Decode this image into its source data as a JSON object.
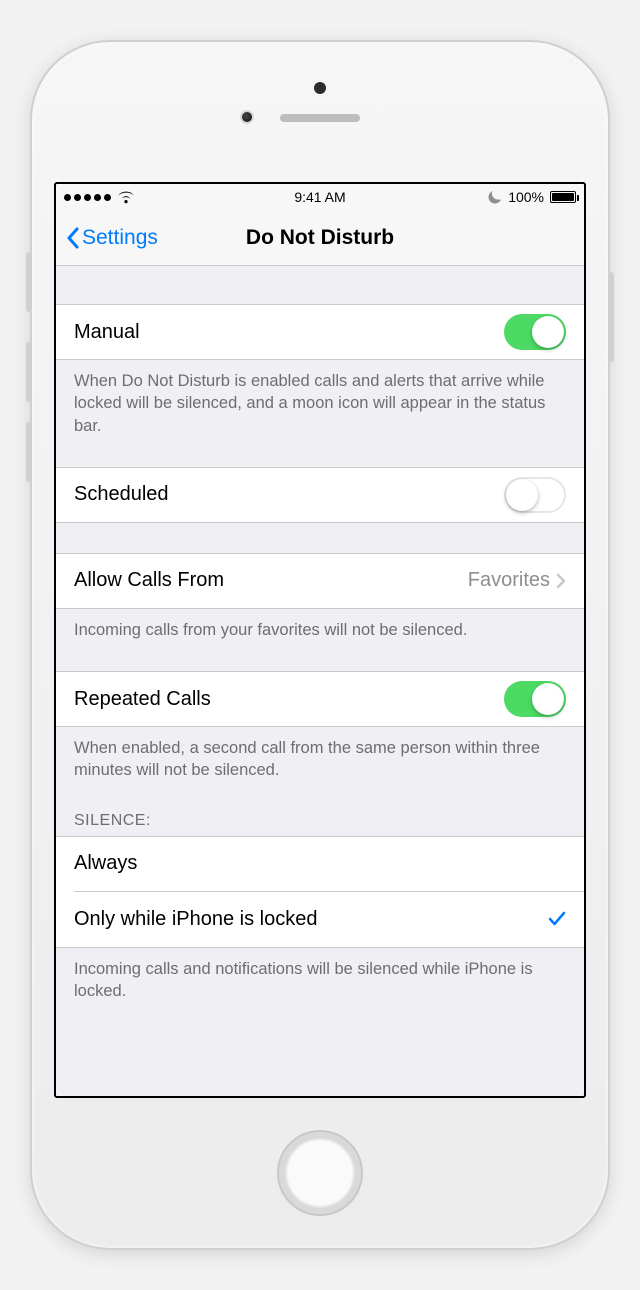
{
  "statusbar": {
    "time": "9:41 AM",
    "battery_pct": "100%",
    "signal_dots": 5,
    "carrier_icon": "wifi",
    "dnd_indicator": "moon"
  },
  "nav": {
    "back_label": "Settings",
    "title": "Do Not Disturb"
  },
  "rows": {
    "manual": {
      "label": "Manual",
      "on": true
    },
    "manual_footer": "When Do Not Disturb is enabled calls and alerts that arrive while locked will be silenced, and a moon icon will appear in the status bar.",
    "scheduled": {
      "label": "Scheduled",
      "on": false
    },
    "allow_calls": {
      "label": "Allow Calls From",
      "value": "Favorites"
    },
    "allow_calls_footer": "Incoming calls from your favorites will not be silenced.",
    "repeated": {
      "label": "Repeated Calls",
      "on": true
    },
    "repeated_footer": "When enabled, a second call from the same person within three minutes will not be silenced.",
    "silence_header": "SILENCE:",
    "silence": {
      "always": "Always",
      "locked": "Only while iPhone is locked",
      "selected": "locked"
    },
    "silence_footer": "Incoming calls and notifications will be silenced while iPhone is locked."
  }
}
